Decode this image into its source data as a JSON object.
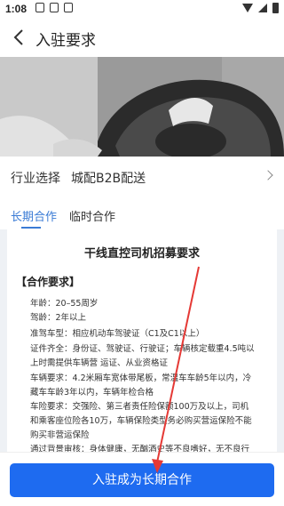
{
  "status_bar": {
    "time": "1:08"
  },
  "header": {
    "title": "入驻要求"
  },
  "industry": {
    "label": "行业选择",
    "value": "城配B2B配送"
  },
  "tabs": [
    {
      "label": "长期合作",
      "active": true
    },
    {
      "label": "临时合作",
      "active": false
    }
  ],
  "card": {
    "title": "干线直控司机招募要求",
    "section_title": "【合作要求】",
    "requirements": [
      "年龄：20–55周岁",
      "驾龄：2年以上",
      "准驾车型：相应机动车驾驶证（C1及C1以上）",
      "证件齐全：身份证、驾驶证、行驶证；车辆核定载重4.5吨以",
      "上时需提供车辆营 运证、从业资格证",
      "车辆要求：4.2米厢车宽体带尾板，常温车车龄5年以内，冷",
      "藏车车龄3年以内，车辆年检合格",
      "车险要求：交强险、第三者责任险保额100万及以上，司机",
      "和乘客座位险各10万，车辆保险类型务必购买营运保险不能",
      "购买非营运保险",
      "通过背景审核：身体健康，无酗酒史等不良嗜好，无不良行"
    ]
  },
  "bottom": {
    "button_label": "入驻成为长期合作"
  },
  "colors": {
    "accent": "#1e6bf0",
    "tab_active": "#3a7bd5",
    "annotation_arrow": "#e53935"
  }
}
